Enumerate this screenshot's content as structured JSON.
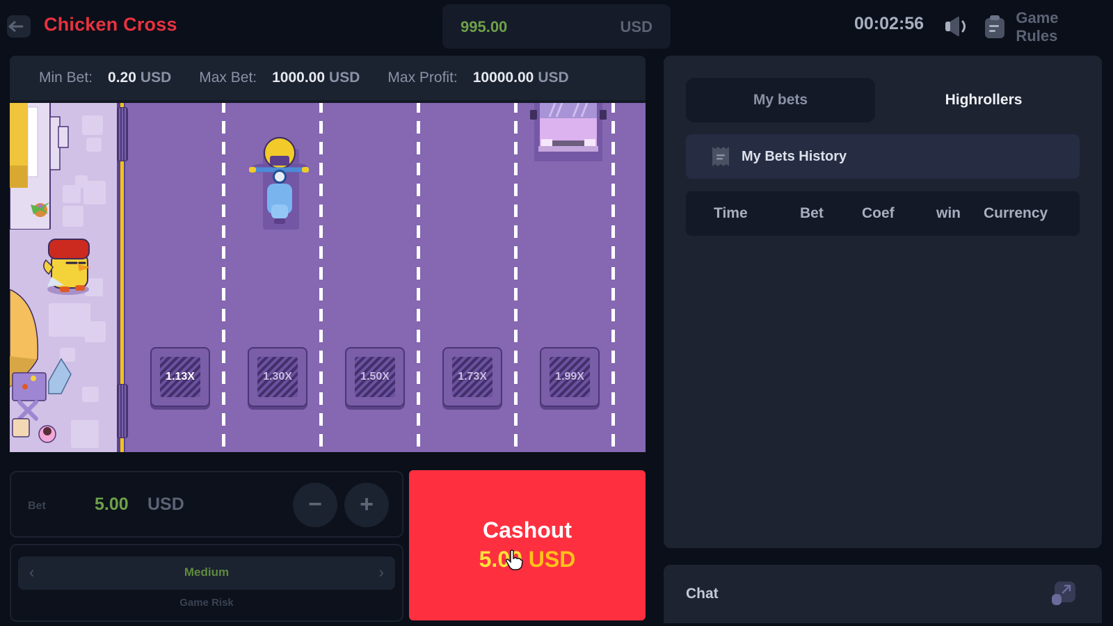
{
  "header": {
    "title": "Chicken Cross",
    "back_icon": "arrow-left-icon",
    "balance": {
      "amount": "995.00",
      "currency": "USD"
    },
    "timer": "00:02:56",
    "sound_icon": "speaker-icon",
    "rules": {
      "icon": "clipboard-icon",
      "label": "Game Rules"
    }
  },
  "limits": {
    "min_bet": {
      "label": "Min Bet:",
      "value": "0.20",
      "currency": "USD"
    },
    "max_bet": {
      "label": "Max Bet:",
      "value": "1000.00",
      "currency": "USD"
    },
    "max_profit": {
      "label": "Max Profit:",
      "value": "10000.00",
      "currency": "USD"
    }
  },
  "game": {
    "multipliers": [
      "1.13X",
      "1.30X",
      "1.50X",
      "1.73X",
      "1.99X"
    ],
    "colors": {
      "road": "#8567b2",
      "sidewalk": "#d1c1e6",
      "curb_line": "#f2c21a"
    }
  },
  "bet": {
    "label": "Bet",
    "value": "5.00",
    "currency": "USD",
    "decrease_symbol": "−",
    "increase_symbol": "+"
  },
  "risk": {
    "value": "Medium",
    "caption": "Game Risk",
    "prev_symbol": "‹",
    "next_symbol": "›"
  },
  "cashout": {
    "label": "Cashout",
    "amount": "5.00",
    "currency": "USD",
    "color": "#fe3040"
  },
  "panel": {
    "tabs": [
      {
        "label": "My bets",
        "active": true
      },
      {
        "label": "Highrollers",
        "active": false
      }
    ],
    "history_title": "My Bets History",
    "columns": [
      "Time",
      "Bet",
      "Coef",
      "win",
      "Currency"
    ]
  },
  "chat": {
    "label": "Chat"
  }
}
